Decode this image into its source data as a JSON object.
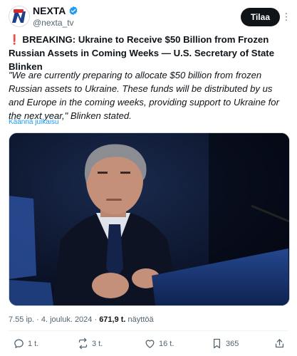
{
  "header": {
    "display_name": "NEXTA",
    "handle": "@nexta_tv",
    "follow_label": "Tilaa",
    "more_label": "⋮"
  },
  "tweet": {
    "headline_icon": "❗",
    "headline": "BREAKING: Ukraine to Receive $50 Billion from Frozen Russian Assets in Coming Weeks — U.S. Secretary of State Blinken",
    "quote": "\"We are currently preparing to allocate $50 billion from frozen Russian assets to Ukraine. These funds will be distributed by us and Europe in the coming weeks, providing support to Ukraine for the next year,\" Blinken stated.",
    "translate_label": "Käännä julkaisu"
  },
  "meta": {
    "timestamp": "7.55 ip. · 4. jouluk. 2024 · ",
    "views_count": "671,9 t.",
    "views_label": " näyttöä"
  },
  "actions": {
    "replies": "1 t.",
    "reposts": "3 t.",
    "likes": "16 t.",
    "bookmarks": "365"
  },
  "colors": {
    "accent": "#1d9bf0",
    "text": "#0f1419",
    "muted": "#536471",
    "button_bg": "#0f1419",
    "logo_red": "#d7272b",
    "logo_navy": "#1f3f8a"
  },
  "icons": [
    "nexta-logo",
    "verified-badge-icon",
    "more-icon",
    "reply-icon",
    "repost-icon",
    "like-icon",
    "bookmark-icon",
    "share-icon"
  ]
}
